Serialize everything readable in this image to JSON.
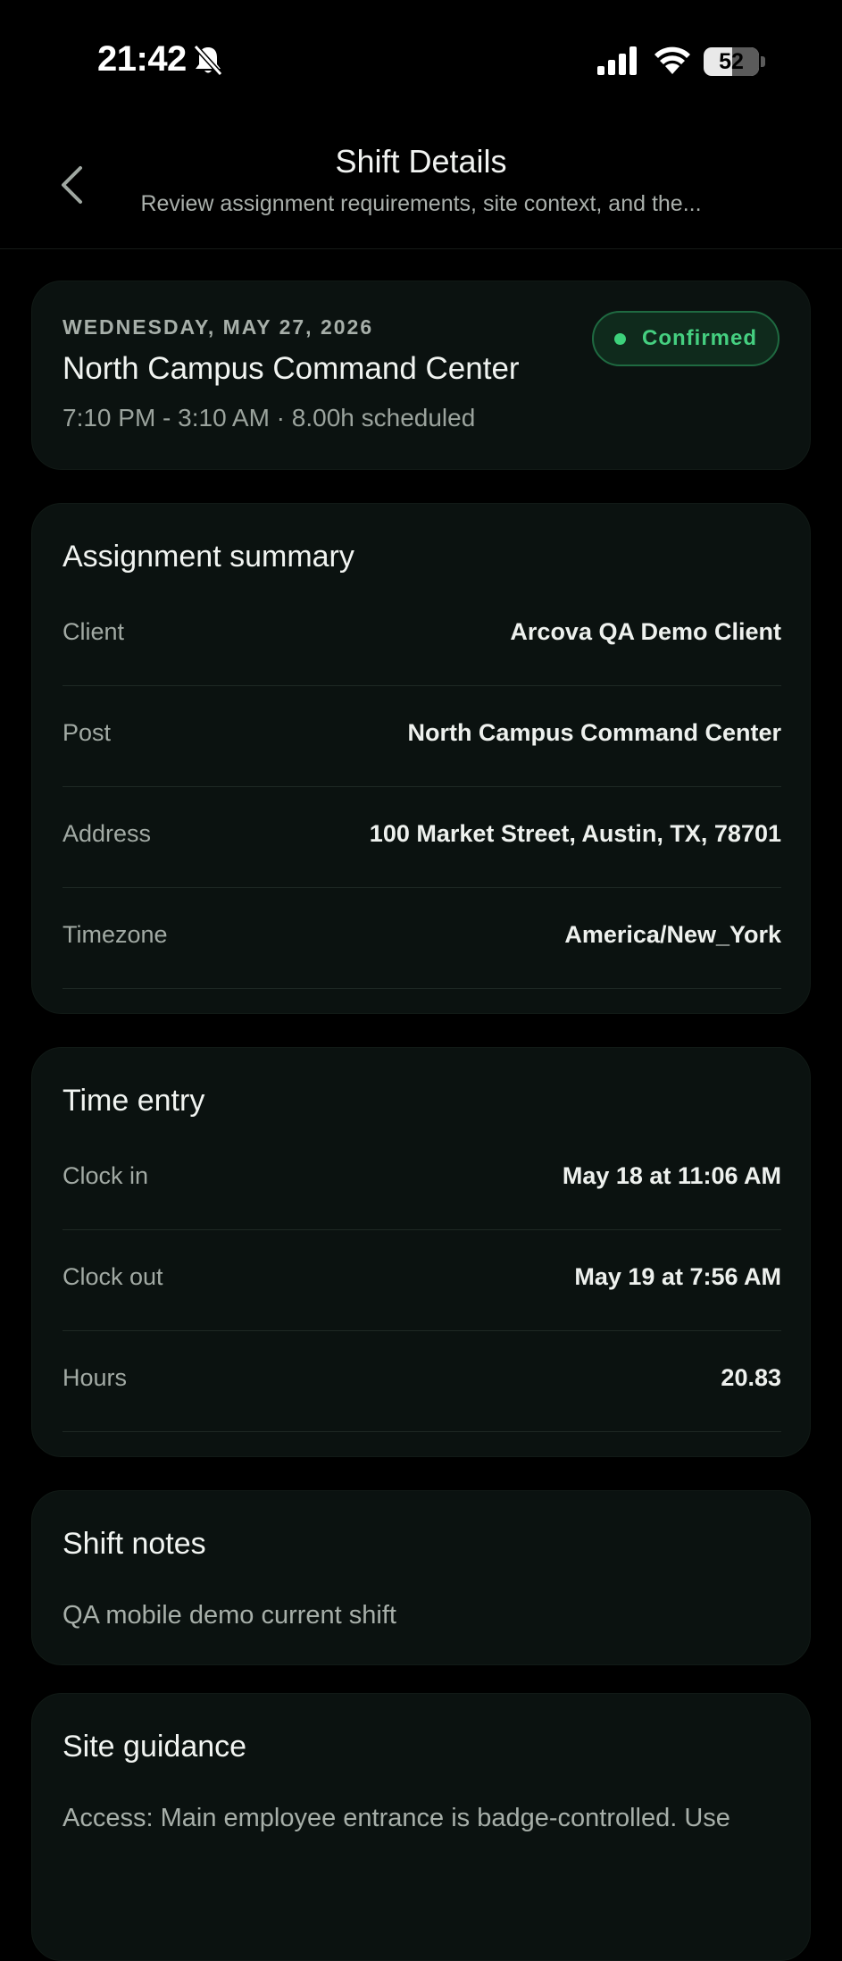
{
  "status_bar": {
    "time": "21:42",
    "battery_level": "52",
    "icons": [
      "bell-slash-icon",
      "cellular-signal-icon",
      "wifi-icon",
      "battery-icon"
    ]
  },
  "header": {
    "title": "Shift Details",
    "subtitle": "Review assignment requirements, site context, and the...",
    "back_icon": "chevron-left-icon"
  },
  "shift": {
    "date": "WEDNESDAY, MAY 27, 2026",
    "site_name": "North Campus Command Center",
    "time_summary": "7:10 PM - 3:10 AM · 8.00h scheduled",
    "status": "Confirmed",
    "status_color": "#45CF80"
  },
  "assignment_summary": {
    "title": "Assignment summary",
    "rows": [
      {
        "label": "Client",
        "value": "Arcova QA Demo Client"
      },
      {
        "label": "Post",
        "value": "North Campus Command Center"
      },
      {
        "label": "Address",
        "value": "100 Market Street, Austin, TX, 78701"
      },
      {
        "label": "Timezone",
        "value": "America/New_York"
      }
    ]
  },
  "time_entry": {
    "title": "Time entry",
    "rows": [
      {
        "label": "Clock in",
        "value": "May 18 at 11:06 AM"
      },
      {
        "label": "Clock out",
        "value": "May 19 at 7:56 AM"
      },
      {
        "label": "Hours",
        "value": "20.83"
      }
    ]
  },
  "shift_notes": {
    "title": "Shift notes",
    "text": "QA mobile demo current shift"
  },
  "site_guidance": {
    "title": "Site guidance",
    "text": "Access: Main employee entrance is badge-controlled. Use"
  },
  "colors": {
    "background": "#000000",
    "card": "#0B1210",
    "accent_green": "#3DD17B"
  }
}
